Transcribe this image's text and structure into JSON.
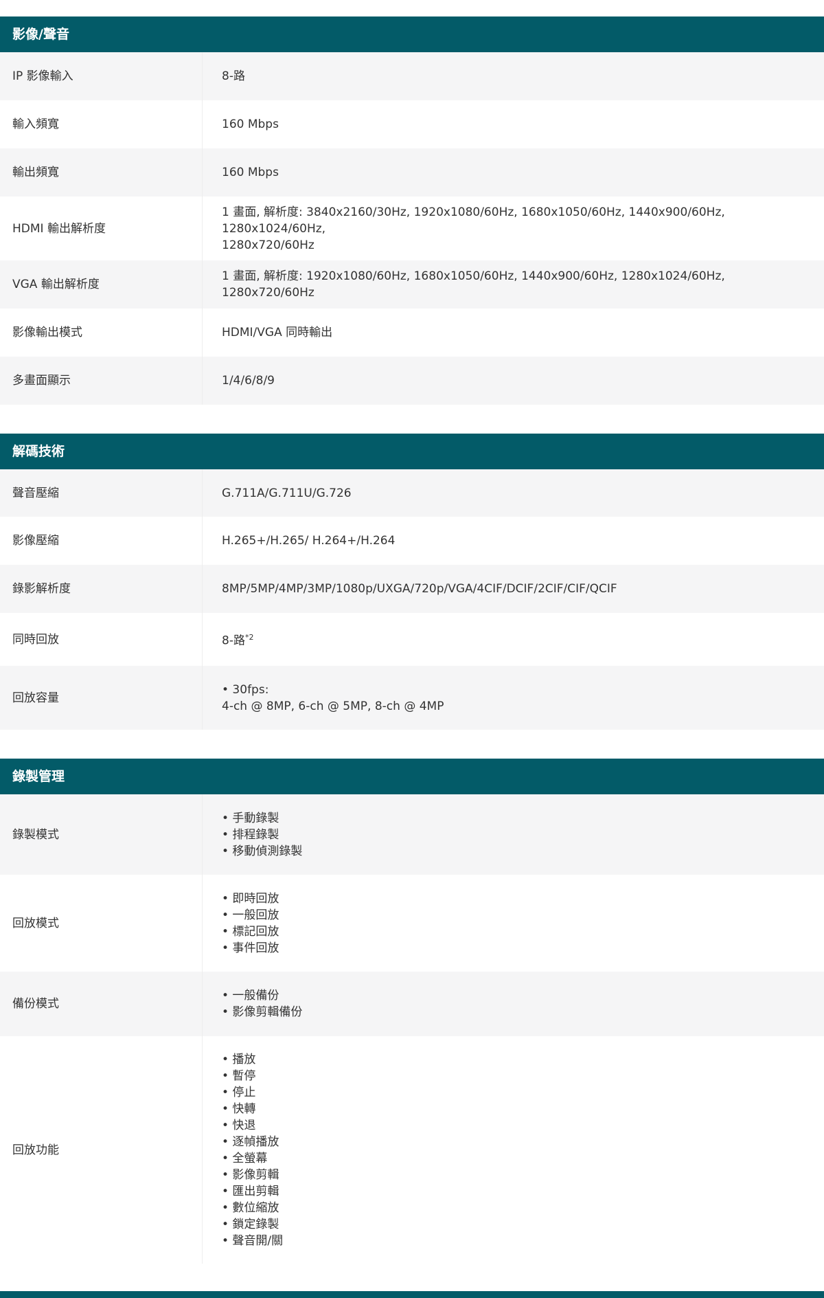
{
  "sections": [
    {
      "title": "影像/聲音",
      "rows": [
        {
          "label": "IP 影像輸入",
          "lines": [
            "8-路"
          ]
        },
        {
          "label": "輸入頻寬",
          "lines": [
            "160 Mbps"
          ]
        },
        {
          "label": "輸出頻寬",
          "lines": [
            "160 Mbps"
          ]
        },
        {
          "label": "HDMI 輸出解析度",
          "lines": [
            "1 畫面, 解析度: 3840x2160/30Hz, 1920x1080/60Hz, 1680x1050/60Hz, 1440x900/60Hz, 1280x1024/60Hz,",
            "1280x720/60Hz"
          ]
        },
        {
          "label": "VGA 輸出解析度",
          "lines": [
            "1 畫面, 解析度: 1920x1080/60Hz, 1680x1050/60Hz, 1440x900/60Hz, 1280x1024/60Hz, 1280x720/60Hz"
          ]
        },
        {
          "label": "影像輸出模式",
          "lines": [
            "HDMI/VGA 同時輸出"
          ]
        },
        {
          "label": "多畫面顯示",
          "lines": [
            "1/4/6/8/9"
          ]
        }
      ]
    },
    {
      "title": "解碼技術",
      "rows": [
        {
          "label": "聲音壓縮",
          "lines": [
            "G.711A/G.711U/G.726"
          ]
        },
        {
          "label": "影像壓縮",
          "lines": [
            "H.265+/H.265/ H.264+/H.264"
          ]
        },
        {
          "label": "錄影解析度",
          "lines": [
            "8MP/5MP/4MP/3MP/1080p/UXGA/720p/VGA/4CIF/DCIF/2CIF/CIF/QCIF"
          ]
        },
        {
          "label": "同時回放",
          "lines": [
            "8-路"
          ],
          "sup": "*2"
        },
        {
          "label": "回放容量",
          "lines": [
            "• 30fps:",
            "4-ch @ 8MP, 6-ch @ 5MP, 8-ch @ 4MP"
          ]
        }
      ]
    },
    {
      "title": "錄製管理",
      "rows": [
        {
          "label": "錄製模式",
          "lines": [
            "• 手動錄製",
            "• 排程錄製",
            "• 移動偵測錄製"
          ]
        },
        {
          "label": "回放模式",
          "lines": [
            "• 即時回放",
            "• 一般回放",
            "• 標記回放",
            "• 事件回放"
          ]
        },
        {
          "label": "備份模式",
          "lines": [
            "• 一般備份",
            "• 影像剪輯備份"
          ]
        },
        {
          "label": "回放功能",
          "lines": [
            "• 播放",
            "• 暫停",
            "• 停止",
            "• 快轉",
            "• 快退",
            "• 逐幀播放",
            "• 全螢幕",
            "• 影像剪輯",
            "• 匯出剪輯",
            "• 數位縮放",
            "• 鎖定錄製",
            "• 聲音開/關"
          ]
        }
      ]
    }
  ]
}
